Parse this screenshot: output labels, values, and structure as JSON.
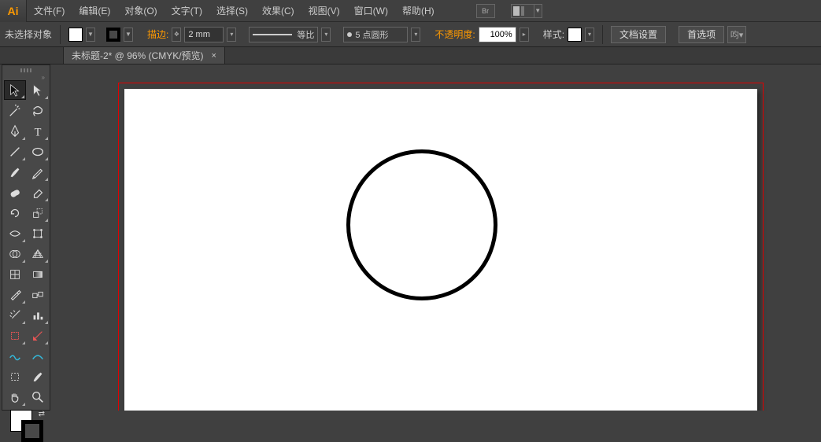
{
  "app": {
    "logo_text": "Ai"
  },
  "menu": {
    "items": [
      "文件(F)",
      "编辑(E)",
      "对象(O)",
      "文字(T)",
      "选择(S)",
      "效果(C)",
      "视图(V)",
      "窗口(W)",
      "帮助(H)"
    ],
    "bridge_label": "Br"
  },
  "control": {
    "selection_status": "未选择对象",
    "stroke_label": "描边:",
    "stroke_weight": "2 mm",
    "profile_label": "等比",
    "brush_label": "5 点圆形",
    "opacity_label": "不透明度:",
    "opacity_value": "100%",
    "style_label": "样式:",
    "doc_setup_btn": "文档设置",
    "prefs_btn": "首选项"
  },
  "doctab": {
    "title": "未标题-2* @ 96% (CMYK/预览)",
    "close": "×"
  },
  "tool_names": [
    "selection-tool",
    "direct-selection-tool",
    "magic-wand-tool",
    "lasso-tool",
    "pen-tool",
    "type-tool",
    "line-tool",
    "ellipse-tool",
    "paintbrush-tool",
    "pencil-tool",
    "blob-brush-tool",
    "eraser-tool",
    "rotate-tool",
    "scale-tool",
    "width-tool",
    "free-transform-tool",
    "shape-builder-tool",
    "perspective-grid-tool",
    "mesh-tool",
    "gradient-tool",
    "eyedropper-tool",
    "blend-tool",
    "symbol-sprayer-tool",
    "column-graph-tool",
    "artboard-tool",
    "slice-tool",
    "wrinkle-tool",
    "smooth-tool",
    "hand-tool",
    "move-tool",
    "zoom-tool",
    "zoom-tool2"
  ]
}
